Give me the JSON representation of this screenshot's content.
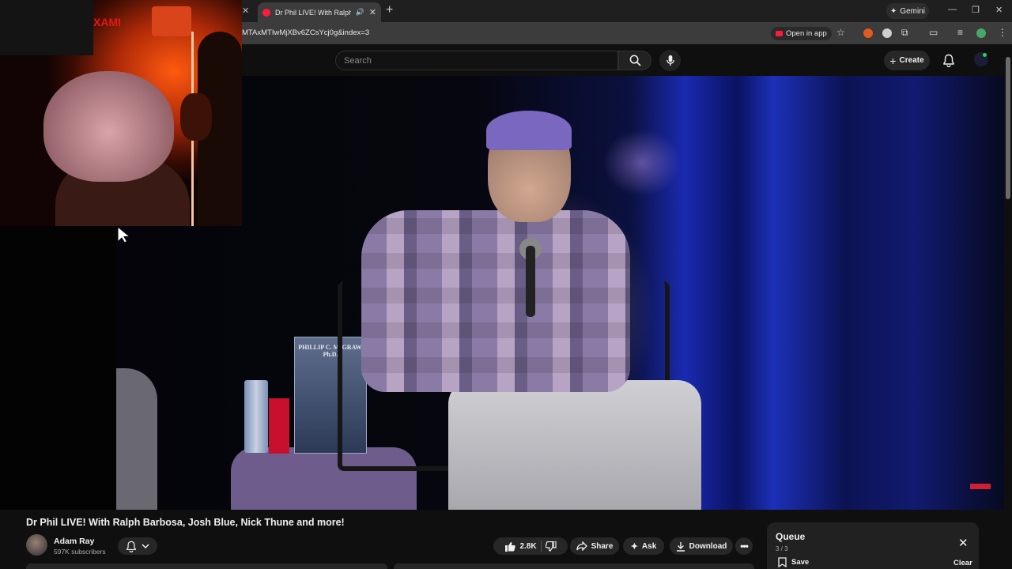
{
  "browser": {
    "tab_title": "Dr Phil LIVE! With Ralph Ba",
    "url": "MTAxMTIwMjXBv6ZCsYcj0g&index=3",
    "open_in_app_label": "Open in app",
    "gemini_label": "Gemini",
    "new_tab_symbol": "+",
    "close_symbol": "✕"
  },
  "masthead": {
    "search_placeholder": "Search",
    "create_label": "Create"
  },
  "webcam": {
    "poster_text": "XAMI"
  },
  "video": {
    "title": "Dr Phil LIVE! With Ralph Barbosa, Josh Blue, Nick Thune and more!",
    "book_author": "PHILLIP C. McGRAW, Ph.D."
  },
  "channel": {
    "name": "Adam Ray",
    "subscribers": "597K subscribers"
  },
  "actions": {
    "like_count": "2.8K",
    "share_label": "Share",
    "ask_label": "Ask",
    "download_label": "Download"
  },
  "queue": {
    "title": "Queue",
    "count": "3 / 3",
    "save_label": "Save",
    "clear_label": "Clear"
  },
  "colors": {
    "background": "#0f0f0f",
    "youtube_red": "#ff1a3c",
    "pill_bg": "#272727",
    "accent_blue": "#1a2ab0"
  }
}
